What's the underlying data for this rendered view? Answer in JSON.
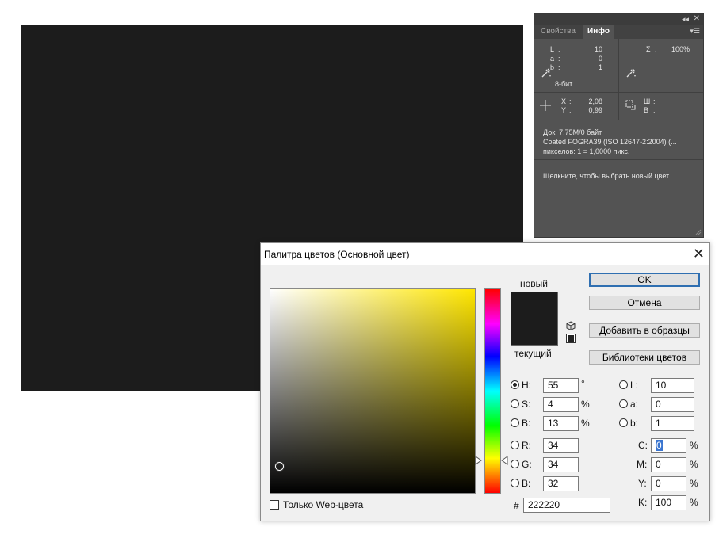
{
  "info_panel": {
    "tabs": [
      "Свойства",
      "Инфо"
    ],
    "active_tab": "Инфо",
    "lab": [
      {
        "label": "L",
        "value": "10"
      },
      {
        "label": "a",
        "value": "0"
      },
      {
        "label": "b",
        "value": "1"
      }
    ],
    "total_label": "Σ",
    "total_value": "100%",
    "bit_depth": "8-бит",
    "x_label": "X",
    "x_value": "2,08",
    "y_label": "Y",
    "y_value": "0,99",
    "w_label": "Ш",
    "h_label": "В",
    "doc_size": "Док: 7,75M/0 байт",
    "profile": "Coated  FOGRA39  (ISO  12647-2:2004)  (...",
    "pixels": "пикселов: 1 = 1,0000 пикс.",
    "hint": "Щелкните, чтобы выбрать новый цвет"
  },
  "dialog": {
    "title": "Палитра цветов (Основной цвет)",
    "new_label": "новый",
    "current_label": "текущий",
    "buttons": {
      "ok": "OK",
      "cancel": "Отмена",
      "add_swatches": "Добавить в образцы",
      "libraries": "Библиотеки цветов"
    },
    "hsb": [
      {
        "label": "H:",
        "value": "55",
        "unit": "°",
        "selected": true
      },
      {
        "label": "S:",
        "value": "4",
        "unit": "%",
        "selected": false
      },
      {
        "label": "B:",
        "value": "13",
        "unit": "%",
        "selected": false
      }
    ],
    "rgb": [
      {
        "label": "R:",
        "value": "34"
      },
      {
        "label": "G:",
        "value": "34"
      },
      {
        "label": "B:",
        "value": "32"
      }
    ],
    "lab": [
      {
        "label": "L:",
        "value": "10"
      },
      {
        "label": "a:",
        "value": "0"
      },
      {
        "label": "b:",
        "value": "1"
      }
    ],
    "cmyk": [
      {
        "label": "C:",
        "value": "0",
        "unit": "%"
      },
      {
        "label": "M:",
        "value": "0",
        "unit": "%"
      },
      {
        "label": "Y:",
        "value": "0",
        "unit": "%"
      },
      {
        "label": "K:",
        "value": "100",
        "unit": "%"
      }
    ],
    "hex_label": "#",
    "hex_value": "222220",
    "web_only_label": "Только Web-цвета",
    "new_color": "#1c1c1c",
    "current_color": "#1c1c1c"
  }
}
